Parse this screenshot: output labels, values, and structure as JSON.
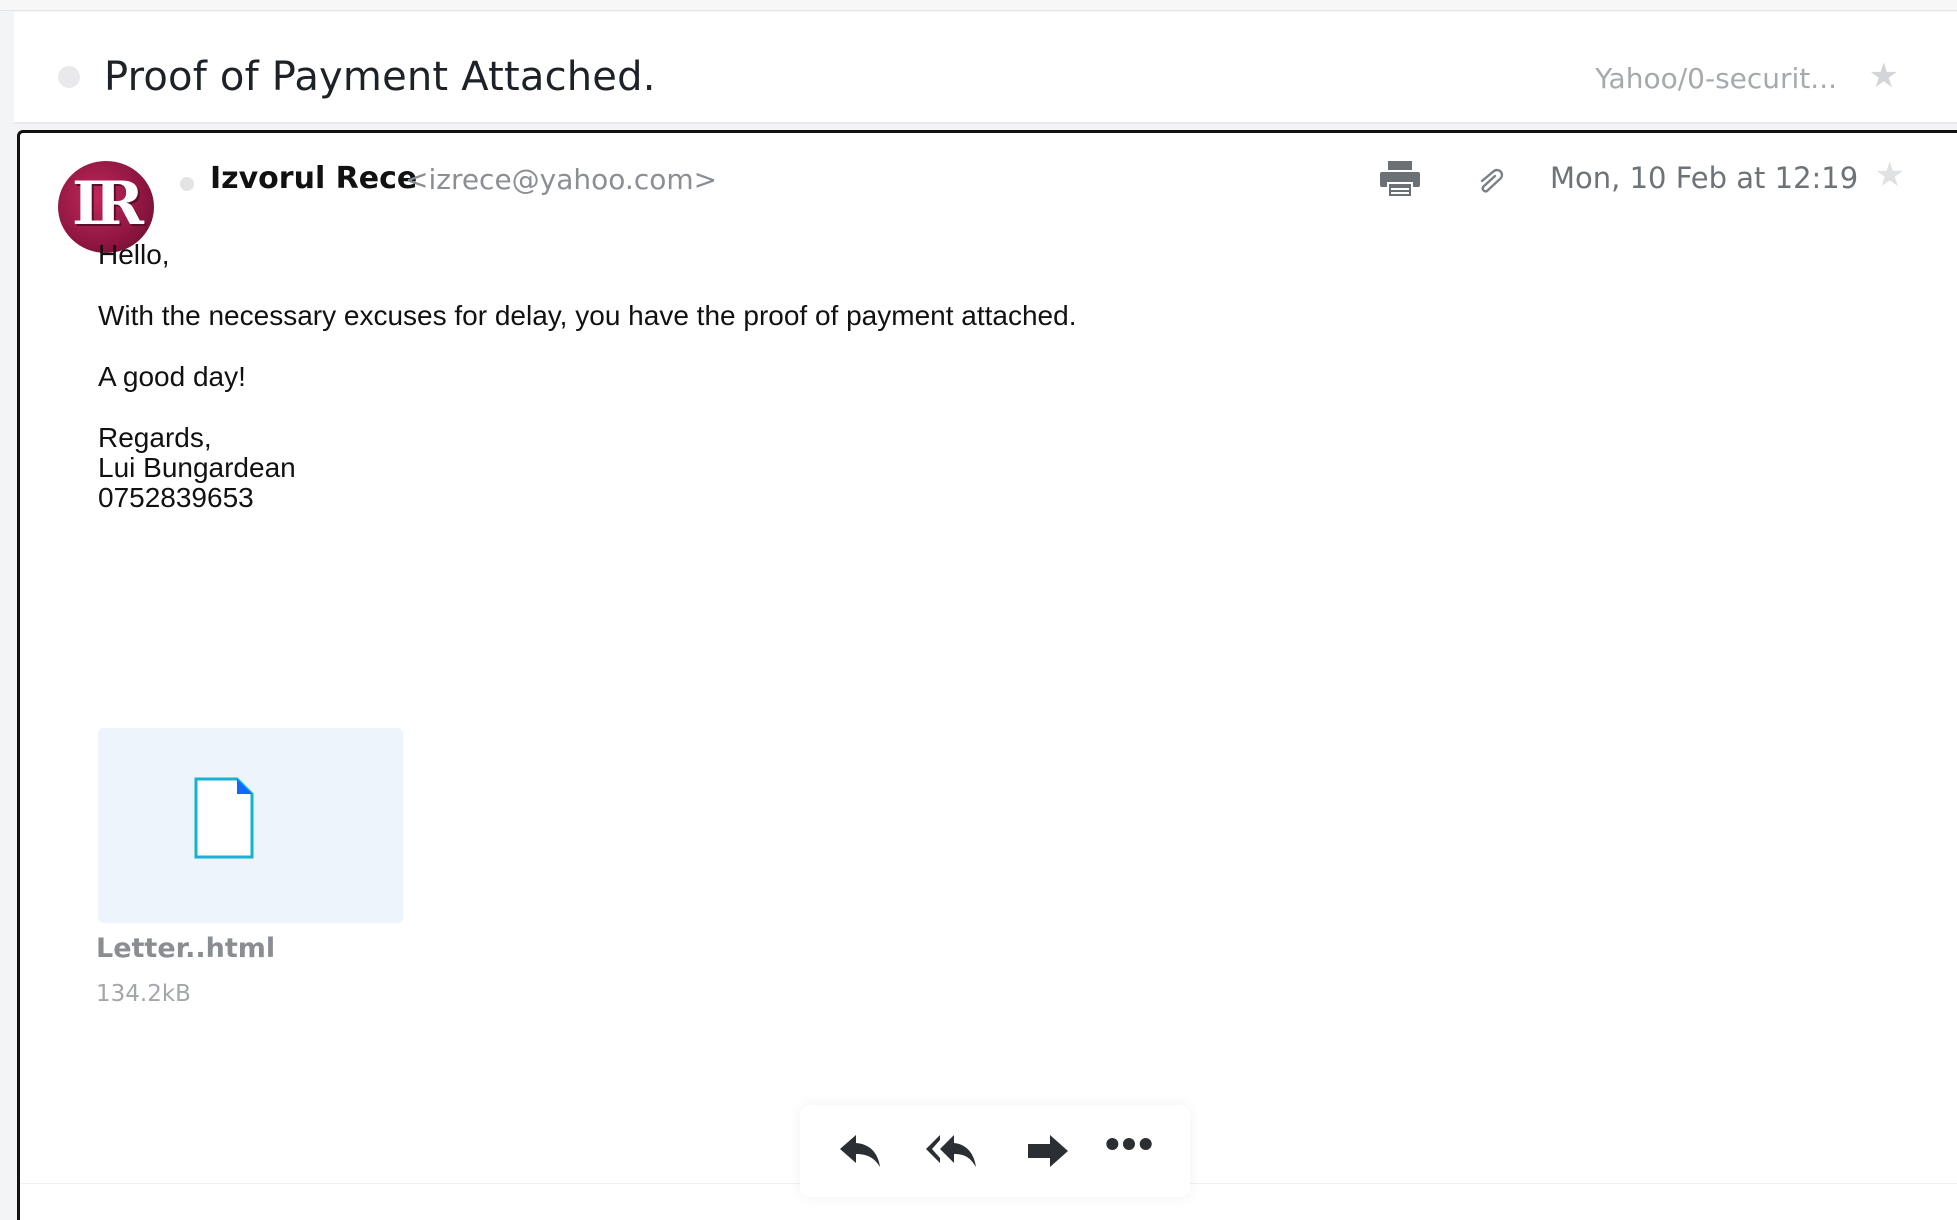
{
  "subject": {
    "title": "Proof of Payment Attached.",
    "folder": "Yahoo/0-securit...",
    "star_icon": "star-icon"
  },
  "message": {
    "avatar_initials": "IR",
    "sender_name": "Izvorul Rece",
    "sender_email": "<izrece@yahoo.com>",
    "date": "Mon, 10 Feb at 12:19",
    "print_icon": "printer-icon",
    "attachment_icon": "paperclip-icon",
    "star_icon": "star-icon"
  },
  "body": {
    "greeting": "Hello,",
    "line1": "With the necessary excuses for delay, you have the proof of payment attached.",
    "line2": "A good day!",
    "signoff": "Regards,",
    "signature_name": "Lui Bungardean",
    "signature_phone": "0752839653"
  },
  "attachment": {
    "file_name": "Letter..html",
    "file_size": "134.2kB",
    "icon": "file-icon"
  },
  "actions": {
    "reply_icon": "reply-icon",
    "reply_all_icon": "reply-all-icon",
    "forward_icon": "forward-icon",
    "more_label": "•••"
  },
  "colors": {
    "accent": "#0f69ff",
    "file_icon_cyan": "#1ab3d6",
    "avatar": "#9b1a4b"
  }
}
